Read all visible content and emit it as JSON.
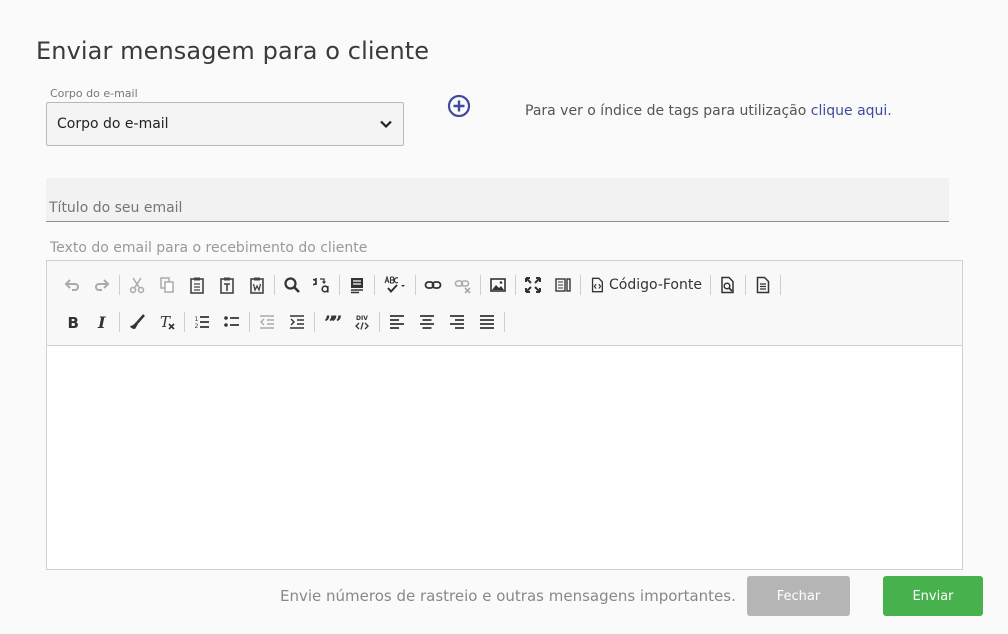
{
  "page": {
    "title": "Enviar mensagem para o cliente"
  },
  "template_select": {
    "label": "Corpo do e-mail",
    "value": "Corpo do e-mail"
  },
  "tags_info": {
    "text": "Para ver o índice de tags para utilização",
    "link": "clique aqui."
  },
  "title_input": {
    "placeholder": "Título do seu email"
  },
  "body_label": "Texto do email para o recebimento do cliente",
  "toolbar": {
    "source_label": "Código-Fonte"
  },
  "footer": {
    "info": "Envie números de rastreio e outras mensagens importantes.",
    "close_label": "Fechar",
    "send_label": "Enviar"
  },
  "colors": {
    "accent": "#3e4a9e",
    "send": "#47b14e",
    "close": "#b5b5b5"
  }
}
